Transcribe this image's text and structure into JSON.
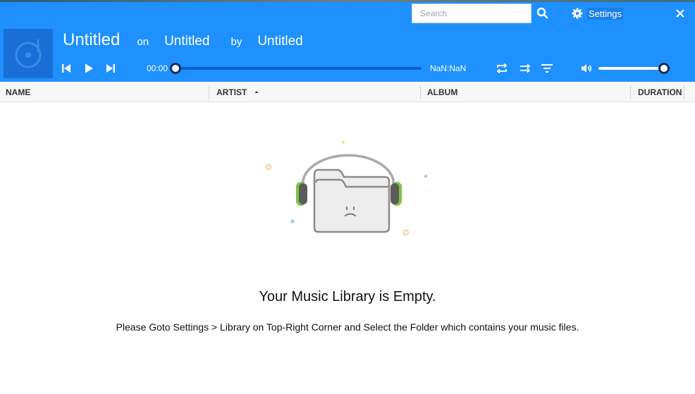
{
  "header": {
    "search_placeholder": "Search",
    "settings_label": "Settings"
  },
  "now_playing": {
    "song": "Untitled",
    "on_label": "on",
    "album": "Untitled",
    "by_label": "by",
    "artist": "Untitled",
    "current_time": "00:00",
    "total_time": "NaN:NaN",
    "seek_progress": 0,
    "volume_level": 1.0
  },
  "columns": [
    {
      "label": "NAME"
    },
    {
      "label": "ARTIST",
      "sorted": "ascending"
    },
    {
      "label": "ALBUM"
    },
    {
      "label": "DURATION"
    }
  ],
  "empty_state": {
    "title": "Your Music Library is Empty.",
    "message": "Please Goto Settings > Library on Top-Right Corner and Select the Folder which contains your music files."
  },
  "colors": {
    "header_bg": "#1e90ff",
    "headphone_accent": "#7cc243"
  },
  "icons": [
    "search-icon",
    "gear-icon",
    "close-icon",
    "album-art-icon",
    "previous-icon",
    "play-icon",
    "next-icon",
    "repeat-icon",
    "shuffle-icon",
    "filter-icon",
    "volume-icon",
    "sort-ascending-icon"
  ]
}
